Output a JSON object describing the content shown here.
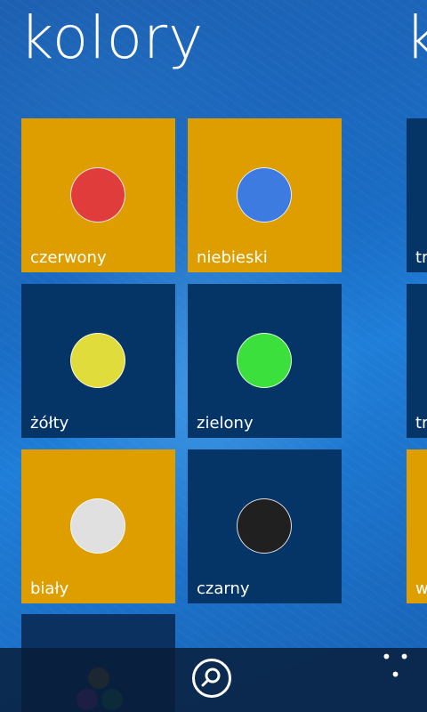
{
  "page": {
    "title": "kolory",
    "next_title": "k"
  },
  "tiles": [
    {
      "label": "czerwony",
      "tile_color": "#de9e00",
      "dot_color": "#e03c3c"
    },
    {
      "label": "niebieski",
      "tile_color": "#de9e00",
      "dot_color": "#3d7be0"
    },
    {
      "label": "żółty",
      "tile_color": "#053566",
      "dot_color": "#e0dc3c"
    },
    {
      "label": "zielony",
      "tile_color": "#053566",
      "dot_color": "#3ce03c"
    },
    {
      "label": "biały",
      "tile_color": "#de9e00",
      "dot_color": "#e0e0e0"
    },
    {
      "label": "czarny",
      "tile_color": "#053566",
      "dot_color": "#202020"
    }
  ],
  "next_panel": {
    "tiles": [
      {
        "label": "tr",
        "tile_color": "#053566"
      },
      {
        "label": "tr",
        "tile_color": "#053566"
      },
      {
        "label": "w",
        "tile_color": "#de9e00"
      }
    ]
  },
  "app_bar": {
    "ellipsis": "• • •",
    "dots": [
      {
        "color": "#7a5a1c"
      },
      {
        "color": "#7a2a7a"
      },
      {
        "color": "#1f6b45"
      }
    ]
  }
}
